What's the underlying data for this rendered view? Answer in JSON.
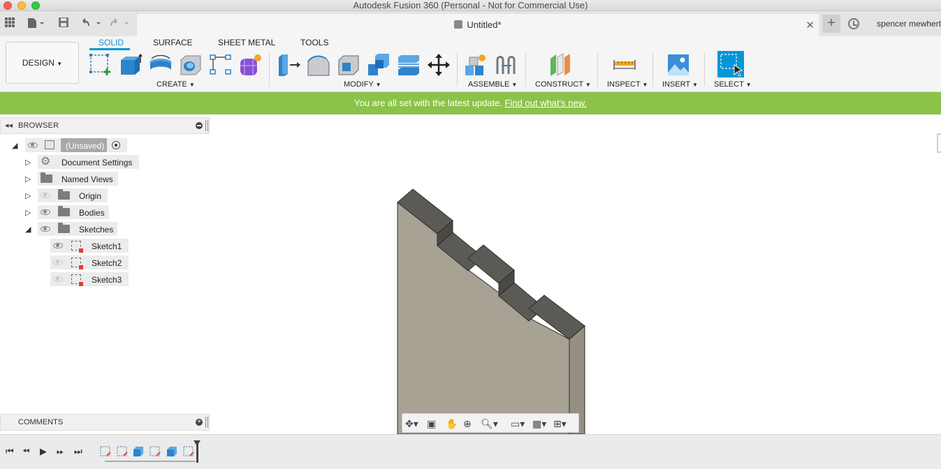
{
  "window": {
    "title": "Autodesk Fusion 360 (Personal - Not for Commercial Use)"
  },
  "tab": {
    "doc_title": "Untitled*",
    "user_name": "spencer mewherter"
  },
  "toolbar": {
    "workspace": "DESIGN",
    "tabs": [
      "SOLID",
      "SURFACE",
      "SHEET METAL",
      "TOOLS"
    ],
    "active_tab": "SOLID",
    "groups": [
      "CREATE",
      "MODIFY",
      "ASSEMBLE",
      "CONSTRUCT",
      "INSPECT",
      "INSERT",
      "SELECT"
    ]
  },
  "banner": {
    "text": "You are all set with the latest update.",
    "link": "Find out what's new."
  },
  "browser": {
    "title": "BROWSER",
    "root": "(Unsaved)",
    "items": [
      "Document Settings",
      "Named Views",
      "Origin",
      "Bodies",
      "Sketches"
    ],
    "sketches": [
      "Sketch1",
      "Sketch2",
      "Sketch3"
    ]
  },
  "comments": {
    "title": "COMMENTS"
  },
  "colors": {
    "accent": "#0696d7",
    "banner": "#8bc34a",
    "part_face": "#a8a295",
    "part_top": "#5b5a55"
  }
}
